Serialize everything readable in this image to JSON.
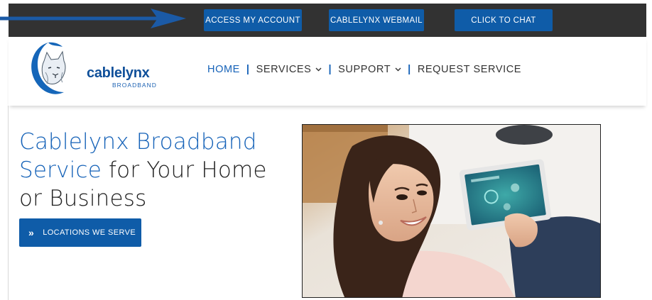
{
  "topbar": {
    "account_label": "ACCESS MY ACCOUNT",
    "webmail_label": "CABLELYNX WEBMAIL",
    "chat_label": "CLICK TO CHAT",
    "bg_color": "#323232",
    "button_color": "#0f5ca8"
  },
  "logo": {
    "word": "cablelynx",
    "sub": "BROADBAND"
  },
  "nav": {
    "items": [
      {
        "label": "HOME",
        "active": true
      },
      {
        "label": "SERVICES",
        "dropdown": true
      },
      {
        "label": "SUPPORT",
        "dropdown": true
      },
      {
        "label": "REQUEST SERVICE"
      }
    ],
    "accent": "#1562b8"
  },
  "hero": {
    "title_blue": "Cablelynx Broadband Service",
    "title_rest": " for Your Home or Business",
    "cta_label": "LOCATIONS WE SERVE",
    "cta_icon": "double-chevron-right-icon"
  },
  "photo": {
    "subject": "woman-with-tablet-photo"
  }
}
